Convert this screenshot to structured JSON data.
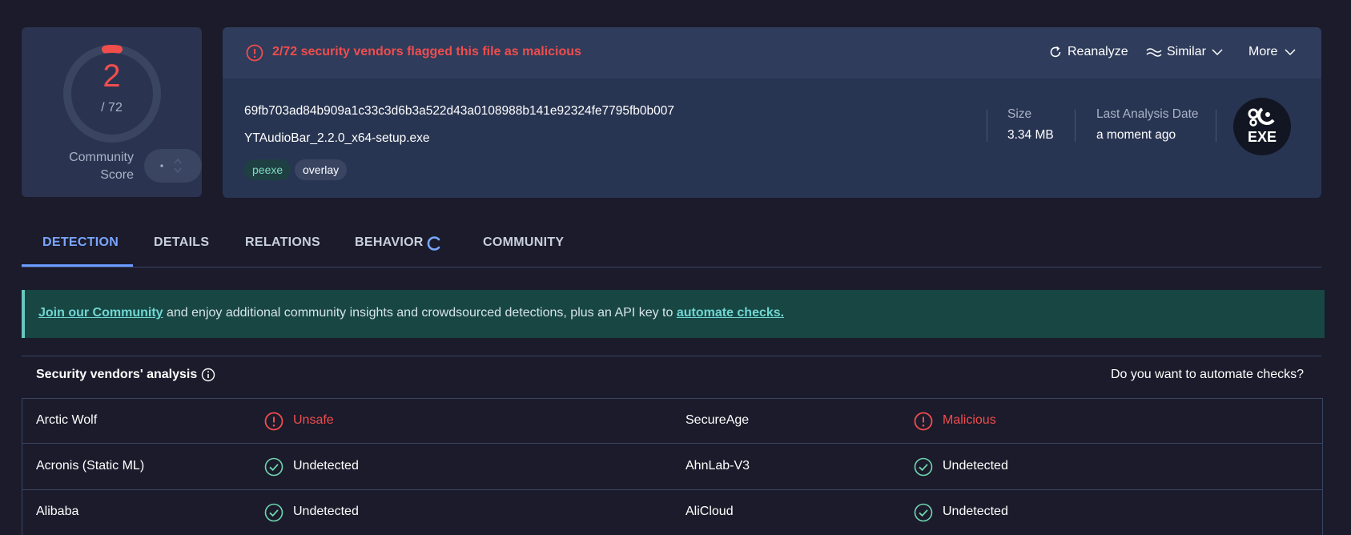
{
  "score": {
    "detections": "2",
    "total": "/ 72",
    "community_label": "Community Score"
  },
  "alert": {
    "text": "2/72 security vendors flagged this file as malicious"
  },
  "toolbar": {
    "reanalyze": "Reanalyze",
    "similar": "Similar",
    "more": "More"
  },
  "file": {
    "hash": "69fb703ad84b909a1c33c3d6b3a522d43a0108988b141e92324fe7795fb0b007",
    "name": "YTAudioBar_2.2.0_x64-setup.exe",
    "tags": [
      "peexe",
      "overlay"
    ],
    "size_label": "Size",
    "size_value": "3.34 MB",
    "date_label": "Last Analysis Date",
    "date_value": "a moment ago",
    "type_badge": "EXE"
  },
  "tabs": [
    "DETECTION",
    "DETAILS",
    "RELATIONS",
    "BEHAVIOR",
    "COMMUNITY"
  ],
  "banner": {
    "link1": "Join our Community",
    "middle": " and enjoy additional community insights and crowdsourced detections, plus an API key to ",
    "link2": "automate checks."
  },
  "vendors": {
    "title": "Security vendors' analysis",
    "automate_question": "Do you want to automate checks?",
    "rows": [
      {
        "left_name": "Arctic Wolf",
        "left_result": "Unsafe",
        "right_name": "SecureAge",
        "right_result": "Malicious"
      },
      {
        "left_name": "Acronis (Static ML)",
        "left_result": "Undetected",
        "right_name": "AhnLab-V3",
        "right_result": "Undetected"
      },
      {
        "left_name": "Alibaba",
        "left_result": "Undetected",
        "right_name": "AliCloud",
        "right_result": "Undetected"
      }
    ]
  },
  "colors": {
    "malicious": "#f04d4d",
    "clean": "#6fd6b0",
    "accent": "#7aa6ff",
    "banner_bg": "#184643"
  }
}
